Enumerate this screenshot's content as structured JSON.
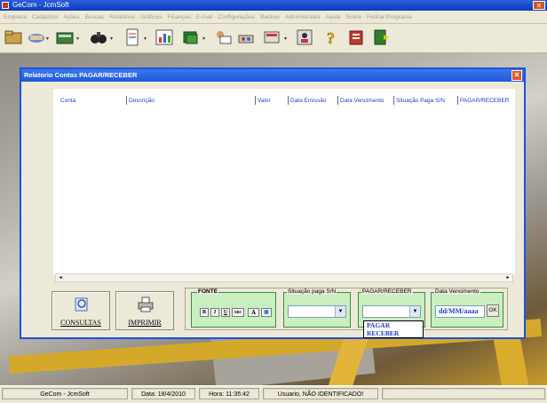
{
  "app": {
    "title": "GeCom - JcmSoft"
  },
  "menu": [
    "Empresa",
    "Cadastros",
    "Ações",
    "Buscas",
    "Relatórios",
    "Gráficos",
    "Finanças",
    "E-mail",
    "Configurações",
    "Backup",
    "Administrador",
    "Ajuda",
    "Sobre",
    "Fechar Programa"
  ],
  "dialog": {
    "title": "Relatorio Contas PAGAR/RECEBER",
    "close_label": "✕",
    "columns": [
      "Conta",
      "Descrição",
      "Valor",
      "Data Emissão",
      "Data Vencimento",
      "Situação Paga S/N",
      "PAGAR/RECEBER"
    ],
    "buttons": {
      "consultas": "CONSULTAS",
      "imprimir": "IMPRIMIR"
    },
    "filters": {
      "fonte_label": "FONTE",
      "font_buttons": [
        "B",
        "I",
        "U",
        "ABC",
        "A",
        "▣"
      ],
      "situacao_label": "Situação paga S/N",
      "situacao_value": "",
      "pagar_receber_label": "PAGAR/RECEBER",
      "pagar_receber_value": "",
      "pagar_receber_options": [
        "PAGAR",
        "RECEBER"
      ],
      "vencimento_label": "Data Vencimento",
      "vencimento_value": "dd/MM/aaaa",
      "ok_label": "OK"
    }
  },
  "status": {
    "app": "GeCom - JcmSoft",
    "date": "Data: 18/4/2010",
    "time": "Hora: 11:35:42",
    "user": "Usuario, NÃO IDENTIFICADO!"
  },
  "colors": {
    "title_blue": "#1e58d8",
    "header_text": "#1a3fd0",
    "filter_green": "#c9eec0",
    "close_red": "#e0542c"
  }
}
